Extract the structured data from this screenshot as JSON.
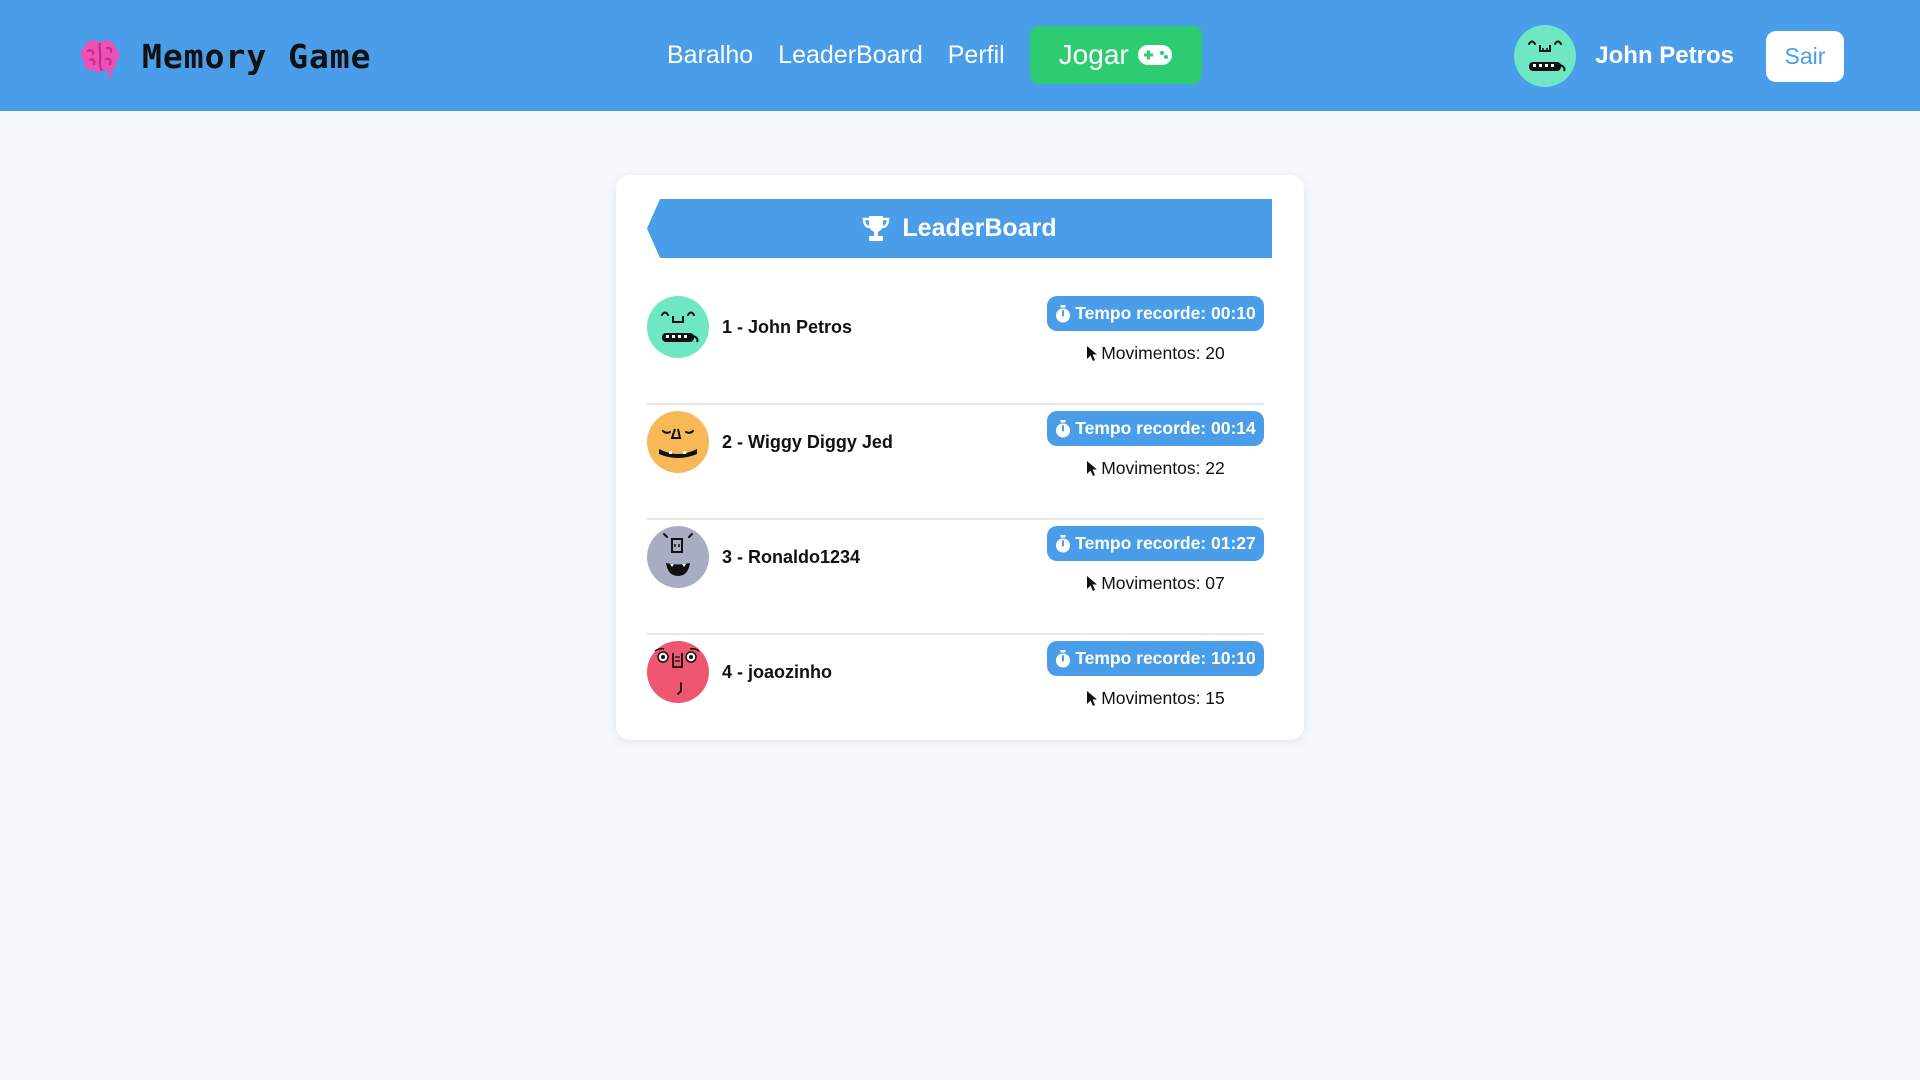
{
  "header": {
    "brand_icon": "brain-icon",
    "brand_title": "Memory Game",
    "nav": {
      "deck_label": "Baralho",
      "leaderboard_label": "LeaderBoard",
      "profile_label": "Perfil",
      "play_label": "Jogar",
      "play_icon": "gamepad-icon"
    },
    "user": {
      "name": "John Petros",
      "logout_label": "Sair"
    }
  },
  "leaderboard": {
    "title": "LeaderBoard",
    "title_icon": "trophy-icon",
    "entries": [
      {
        "label": "1 - John Petros",
        "time": "Tempo recorde: 00:10",
        "moves": "Movimentos: 20",
        "avatar_color": "#6ee7c2"
      },
      {
        "label": "2 - Wiggy Diggy Jed",
        "time": "Tempo recorde: 00:14",
        "moves": "Movimentos: 22",
        "avatar_color": "#f6b955"
      },
      {
        "label": "3 - Ronaldo1234",
        "time": "Tempo recorde: 01:27",
        "moves": "Movimentos: 07",
        "avatar_color": "#a9adc4"
      },
      {
        "label": "4 - joaozinho",
        "time": "Tempo recorde: 10:10",
        "moves": "Movimentos: 15",
        "avatar_color": "#ef5670"
      }
    ]
  },
  "colors": {
    "primary": "#4a9de9",
    "play_green": "#2ecc71",
    "background": "#f5f9fd",
    "brain_pink": "#f04fb5"
  }
}
